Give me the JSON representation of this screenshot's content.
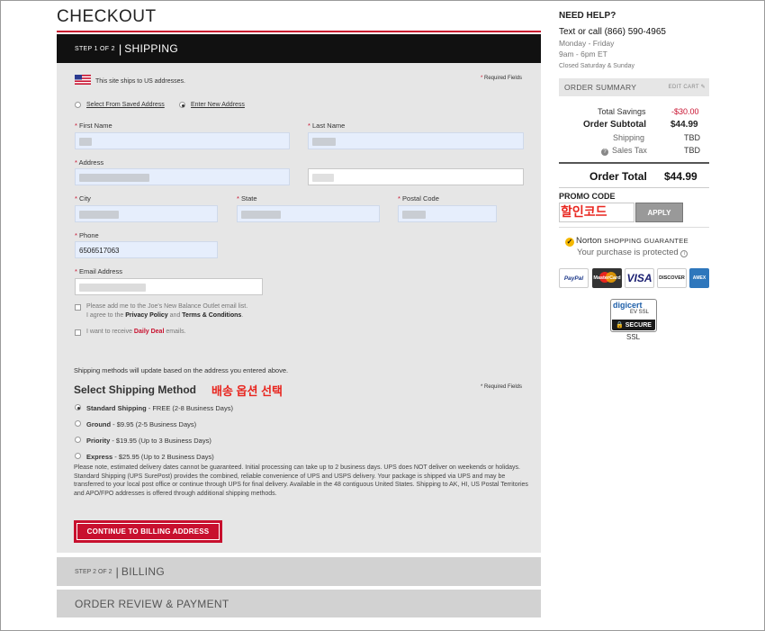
{
  "page": {
    "title": "CHECKOUT"
  },
  "step1": {
    "step_text": "STEP 1 OF 2",
    "name": "SHIPPING"
  },
  "shipping_form": {
    "ships_note": "This site ships to US addresses.",
    "required_note": "* Required Fields",
    "address_options": [
      "Select From Saved Address",
      "Enter New Address"
    ],
    "selected_option": "Enter New Address",
    "labels": {
      "first_name": "First Name",
      "last_name": "Last Name",
      "address": "Address",
      "city": "City",
      "state": "State",
      "postal_code": "Postal Code",
      "phone": "Phone",
      "email": "Email Address"
    },
    "phone_value": "6506517063",
    "newsletter_text": "Please add me to the Joe's New Balance Outlet email list.",
    "agree_prefix": "I agree to the",
    "privacy_link": "Privacy Policy",
    "agree_and": "and",
    "terms_link": "Terms & Conditions",
    "agree_suffix": ".",
    "daily_prefix": "I want to receive",
    "daily_link": "Daily Deal",
    "daily_suffix": "emails."
  },
  "shipping_method": {
    "update_note": "Shipping methods will update based on the address you entered above.",
    "title": "Select Shipping Method",
    "annotation": "배송 옵션 선택",
    "required_note": "* Required Fields",
    "options": [
      {
        "name": "Standard Shipping",
        "detail": " - FREE (2-8 Business Days)",
        "selected": true
      },
      {
        "name": "Ground",
        "detail": " - $9.95 (2-5 Business Days)",
        "selected": false
      },
      {
        "name": "Priority",
        "detail": " - $19.95 (Up to 3 Business Days)",
        "selected": false
      },
      {
        "name": "Express",
        "detail": " - $25.95 (Up to 2 Business Days)",
        "selected": false
      }
    ],
    "disclaimer": "Please note, estimated delivery dates cannot be guaranteed. Initial processing can take up to 2 business days. UPS does NOT deliver on weekends or holidays. Standard Shipping (UPS SurePost) provides the combined, reliable convenience of UPS and USPS delivery. Your package is shipped via UPS and may be transferred to your local post office or continue through UPS for final delivery. Available in the 48 contiguous United States. Shipping to AK, HI, US Postal Territories and APO/FPO addresses is offered through additional shipping methods.",
    "continue_label": "CONTINUE TO BILLING ADDRESS"
  },
  "step2": {
    "step_text": "STEP 2 OF 2",
    "name": "BILLING"
  },
  "step3": {
    "name": "ORDER REVIEW & PAYMENT"
  },
  "help": {
    "title": "NEED HELP?",
    "contact": "Text or call (866) 590-4965",
    "days": "Monday - Friday",
    "hours": "9am - 6pm ET",
    "closed": "Closed Saturday & Sunday"
  },
  "order_summary": {
    "title": "ORDER SUMMARY",
    "edit_label": "EDIT CART",
    "total_savings_label": "Total Savings",
    "total_savings_value": "-$30.00",
    "subtotal_label": "Order Subtotal",
    "subtotal_value": "$44.99",
    "shipping_label": "Shipping",
    "shipping_value": "TBD",
    "tax_label": "Sales Tax",
    "tax_value": "TBD",
    "order_total_label": "Order Total",
    "order_total_value": "$44.99"
  },
  "promo": {
    "label": "PROMO CODE",
    "annotation": "할인코드",
    "apply_label": "APPLY"
  },
  "trust": {
    "norton_brand": "Norton",
    "norton_guarantee": "SHOPPING GUARANTEE",
    "norton_sub": "Your purchase is protected",
    "cards": [
      "PayPal",
      "MasterCard",
      "VISA",
      "DISCOVER",
      "AMEX"
    ],
    "digicert_brand": "digicert",
    "digicert_ev": "EV SSL",
    "digicert_secure": "SECURE",
    "ssl": "SSL"
  },
  "colors": {
    "accent": "#c8102e",
    "annotation": "#e8261f",
    "dark_bar": "#111111",
    "panel": "#e6e6e6"
  }
}
